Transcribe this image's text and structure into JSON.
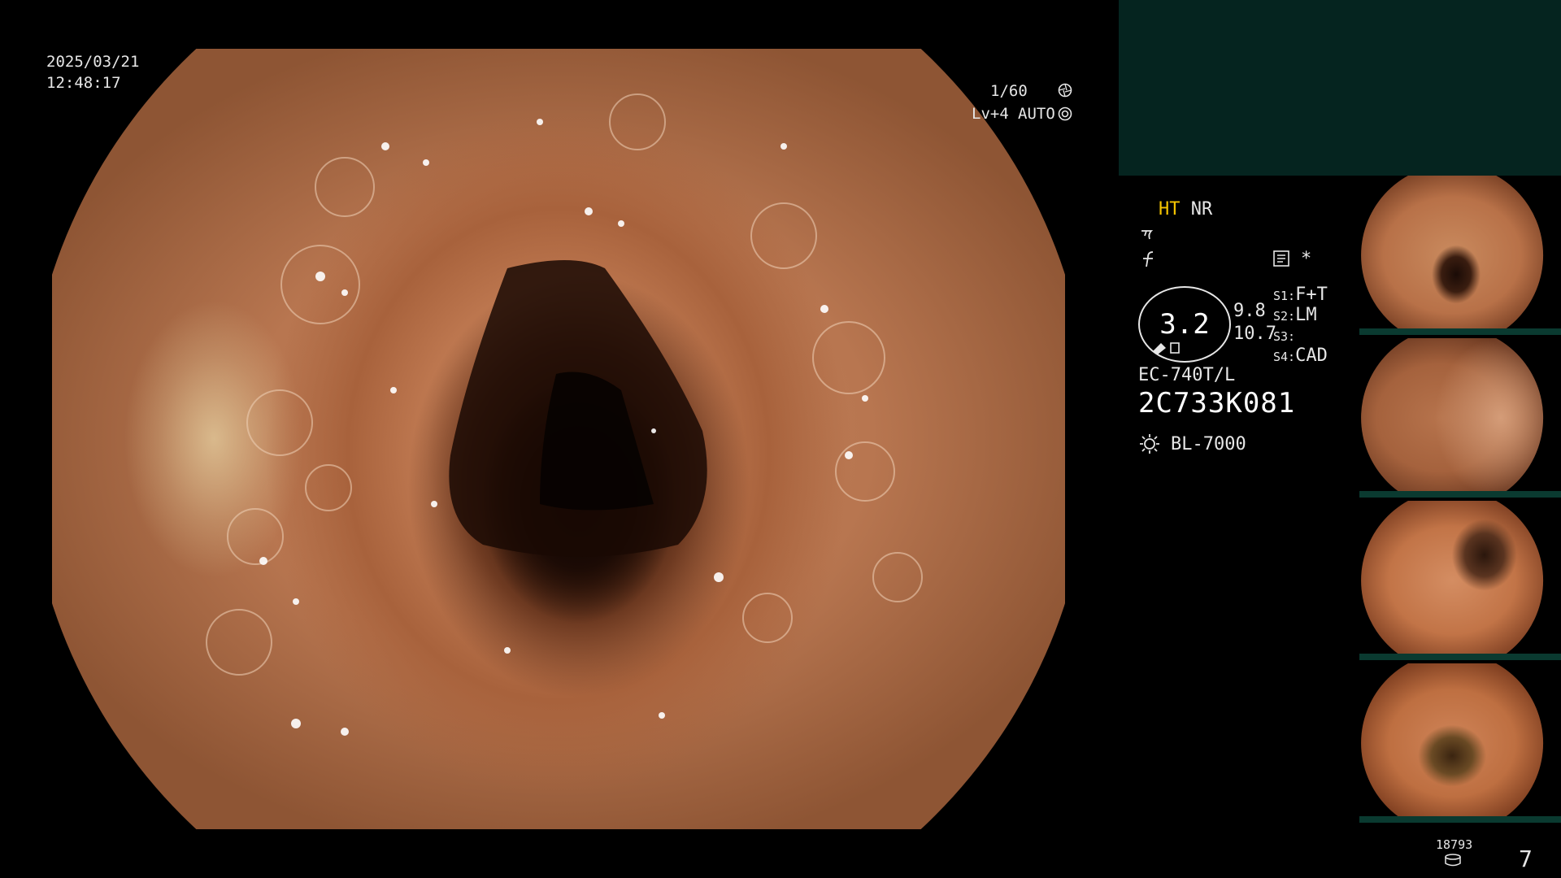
{
  "overlay": {
    "date": "2025/03/21",
    "time": "12:48:17",
    "shutter": "1/60",
    "level": "Lv+4",
    "mode": "AUTO"
  },
  "panel": {
    "ht": "HT",
    "nr": "NR",
    "zoom_value": "3.2",
    "value_a": "9.8",
    "value_b": "10.7",
    "s1_key": "S1:",
    "s1_val": "F+T",
    "s2_key": "S2:",
    "s2_val": "LM",
    "s3_key": "S3:",
    "s3_val": "",
    "s4_key": "S4:",
    "s4_val": "CAD",
    "asterisk": "*",
    "scope_model": "EC-740T/L",
    "serial": "2C733K081",
    "light_source": "BL-7000"
  },
  "footer": {
    "storage_count": "18793",
    "image_count": "7"
  },
  "icons": {
    "shutter": "aperture-icon",
    "auto": "iris-icon",
    "structure": "structure-enhance-icon",
    "color": "color-enhance-icon",
    "record": "record-icon",
    "light": "light-source-icon",
    "storage": "storage-disk-icon"
  },
  "thumbnails": [
    {
      "label": "thumbnail-1"
    },
    {
      "label": "thumbnail-2"
    },
    {
      "label": "thumbnail-3"
    },
    {
      "label": "thumbnail-4"
    }
  ],
  "colors": {
    "accent_yellow": "#f5c400",
    "panel_dark": "#05241f"
  }
}
